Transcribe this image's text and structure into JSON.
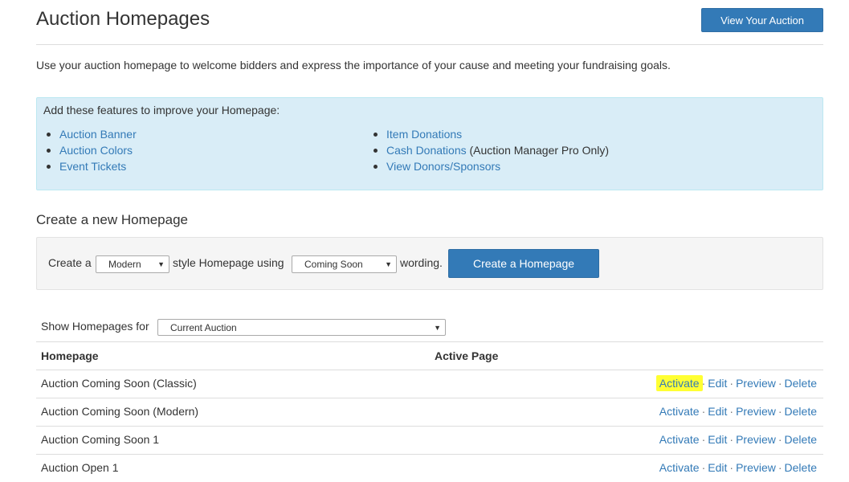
{
  "header": {
    "title": "Auction Homepages",
    "view_button": "View Your Auction"
  },
  "intro": "Use your auction homepage to welcome bidders and express the importance of your cause and meeting your fundraising goals.",
  "features": {
    "title": "Add these features to improve your Homepage:",
    "col1": [
      "Auction Banner",
      "Auction Colors",
      "Event Tickets"
    ],
    "col2": [
      "Item Donations",
      "Cash Donations",
      "View Donors/Sponsors"
    ],
    "cash_note": "(Auction Manager Pro Only)"
  },
  "create": {
    "section_title": "Create a new Homepage",
    "prefix": "Create a",
    "style_value": "Modern",
    "middle": "style Homepage using",
    "wording_value": "Coming Soon",
    "suffix": "wording.",
    "button": "Create a Homepage"
  },
  "filter": {
    "label": "Show Homepages for",
    "value": "Current Auction"
  },
  "table": {
    "headers": [
      "Homepage",
      "Active Page"
    ],
    "actions": {
      "activate": "Activate",
      "edit": "Edit",
      "preview": "Preview",
      "delete": "Delete",
      "separator": "·"
    },
    "rows": [
      {
        "name": "Auction Coming Soon (Classic)"
      },
      {
        "name": "Auction Coming Soon (Modern)"
      },
      {
        "name": "Auction Coming Soon 1"
      },
      {
        "name": "Auction Open 1"
      }
    ]
  },
  "colors": {
    "primary": "#337ab7",
    "info_bg": "#d9edf7",
    "highlight": "#ffff33"
  },
  "icons": {
    "select_arrow": "chevron-down-icon"
  }
}
